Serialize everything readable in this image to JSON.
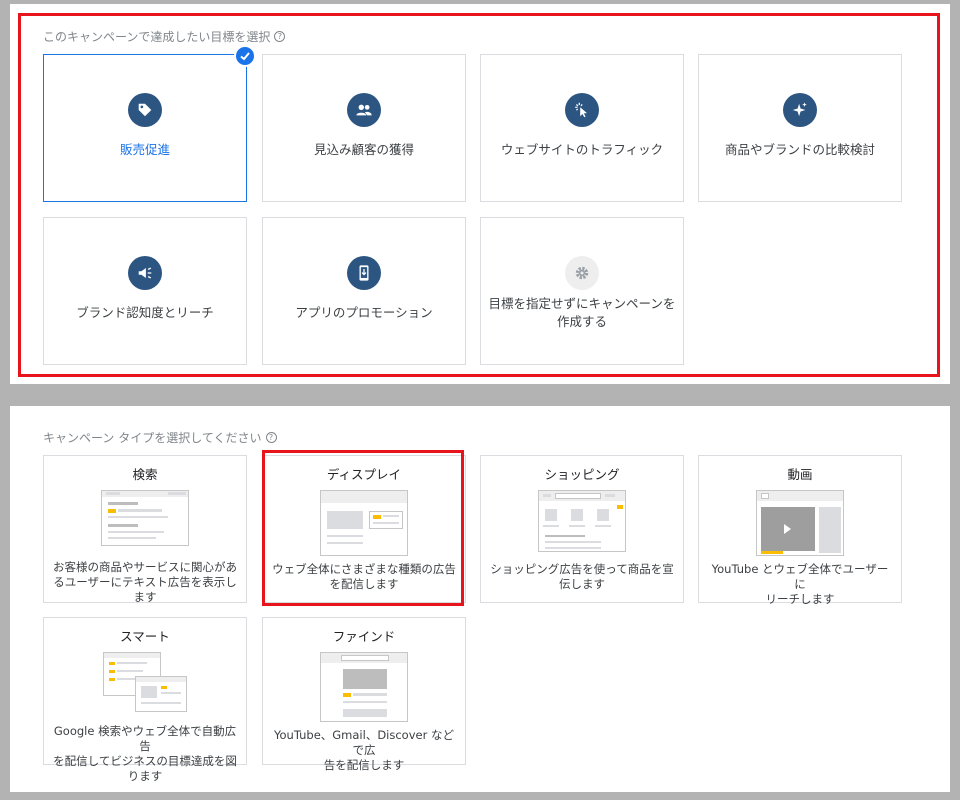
{
  "goals": {
    "title": "このキャンペーンで達成したい目標を選択",
    "help": "?",
    "items": [
      {
        "label": "販売促進",
        "icon": "tag-icon",
        "selected": true
      },
      {
        "label": "見込み顧客の獲得",
        "icon": "people-icon",
        "selected": false
      },
      {
        "label": "ウェブサイトのトラフィック",
        "icon": "cursor-click-icon",
        "selected": false
      },
      {
        "label": "商品やブランドの比較検討",
        "icon": "sparkle-icon",
        "selected": false
      },
      {
        "label": "ブランド認知度とリーチ",
        "icon": "megaphone-icon",
        "selected": false
      },
      {
        "label": "アプリのプロモーション",
        "icon": "phone-download-icon",
        "selected": false
      },
      {
        "label_line1": "目標を指定せずにキャンペーンを",
        "label_line2": "作成する",
        "icon": "gear-icon",
        "selected": false
      }
    ]
  },
  "types": {
    "title": "キャンペーン タイプを選択してください",
    "help": "?",
    "items": [
      {
        "name": "検索",
        "desc_line1": "お客様の商品やサービスに関心があ",
        "desc_line2": "るユーザーにテキスト広告を表示し",
        "desc_line3": "ます"
      },
      {
        "name": "ディスプレイ",
        "desc_line1": "ウェブ全体にさまざまな種類の広告",
        "desc_line2": "を配信します",
        "highlighted": true
      },
      {
        "name": "ショッピング",
        "desc_line1": "ショッピング広告を使って商品を宣",
        "desc_line2": "伝します"
      },
      {
        "name": "動画",
        "desc_line1": "YouTube とウェブ全体でユーザーに",
        "desc_line2": "リーチします"
      },
      {
        "name": "スマート",
        "desc_line1": "Google 検索やウェブ全体で自動広告",
        "desc_line2": "を配信してビジネスの目標達成を図",
        "desc_line3": "ります"
      },
      {
        "name": "ファインド",
        "desc_line1": "YouTube、Gmail、Discover などで広",
        "desc_line2": "告を配信します"
      }
    ]
  },
  "colors": {
    "accent": "#1a73e8",
    "icon_bg": "#2c5582",
    "highlight_frame": "#e8141c",
    "illustration_yellow": "#fbbc04"
  }
}
